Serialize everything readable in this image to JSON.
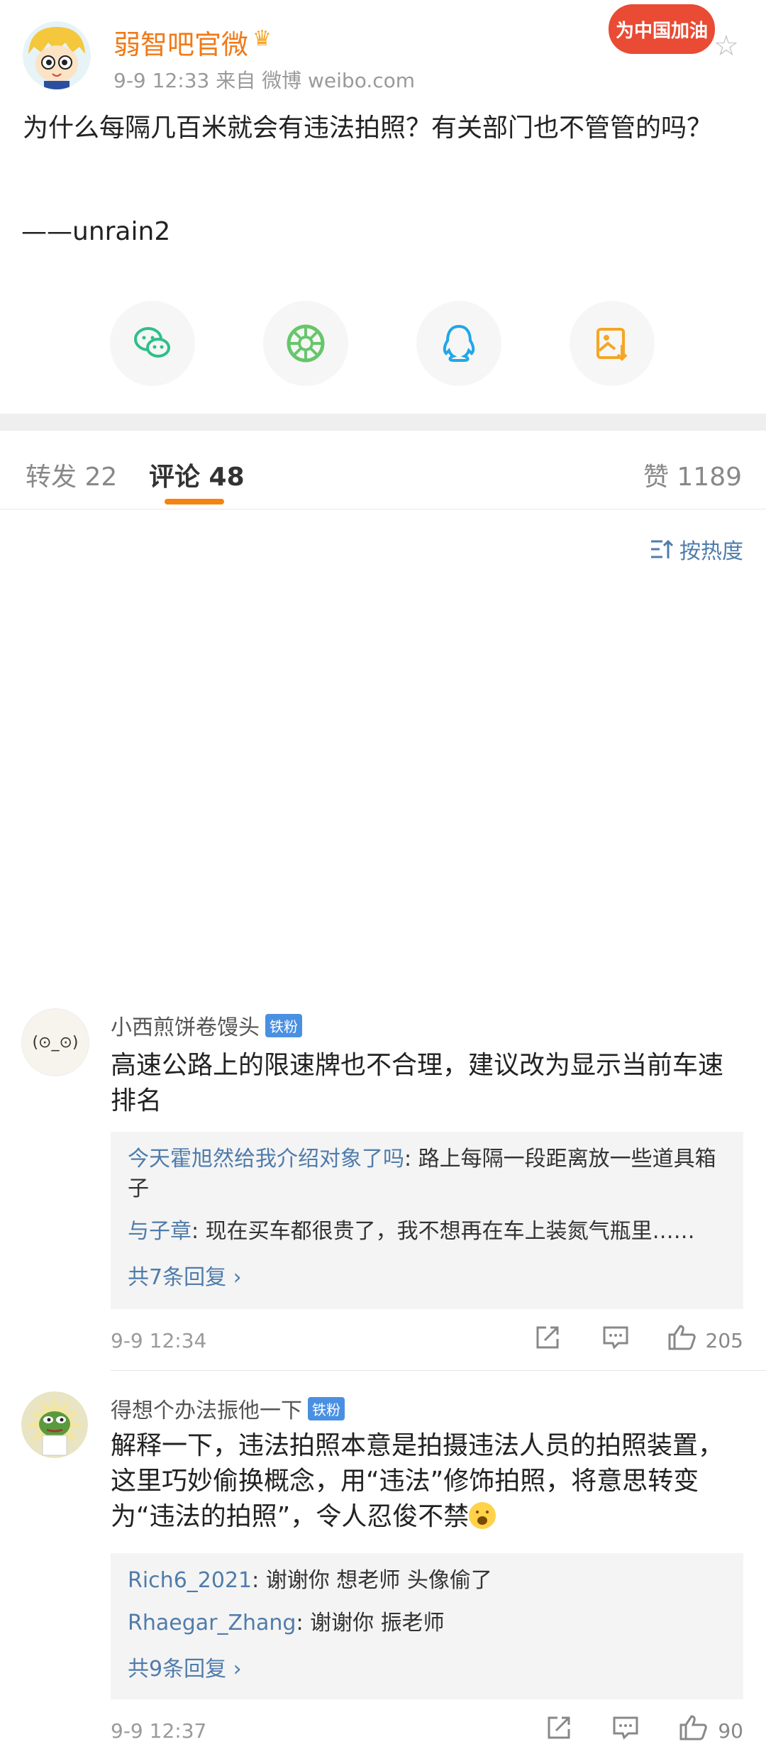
{
  "post": {
    "author": "弱智吧官微",
    "meta": "9-9 12:33   来自 微博 weibo.com",
    "promo_label": "为中国加油",
    "text": "为什么每隔几百米就会有违法拍照？有关部门也不管管的吗？",
    "signature": "——unrain2"
  },
  "share": {
    "icons": [
      "wechat-icon",
      "moments-icon",
      "qq-icon",
      "save-image-icon"
    ],
    "colors": [
      "#2dc089",
      "#66c66b",
      "#1fa7e8",
      "#f5a623"
    ]
  },
  "tabs": {
    "repost": "转发 22",
    "comments": "评论 48",
    "likes": "赞 1189"
  },
  "sort_label": "按热度",
  "comments": [
    {
      "user": "小西煎饼卷馒头",
      "badge": "铁粉",
      "avatar_text": "(⊙_⊙)",
      "text": "高速公路上的限速牌也不合理，建议改为显示当前车速排名",
      "replies": [
        {
          "user": "今天霍旭然给我介绍对象了吗",
          "text": ": 路上每隔一段距离放一些道具箱子"
        },
        {
          "user": "与子章",
          "text": ": 现在买车都很贵了，我不想再在车上装氮气瓶里……"
        }
      ],
      "more": "共7条回复 ›",
      "time": "9-9 12:34",
      "likes": "205"
    },
    {
      "user": "得想个办法振他一下",
      "badge": "铁粉",
      "text": "解释一下，违法拍照本意是拍摄违法人员的拍照装置，这里巧妙偷换概念，用“违法”修饰拍照，将意思转变为“违法的拍照”，令人忍俊不禁",
      "replies": [
        {
          "user": "Rich6_2021",
          "text": ": 谢谢你 想老师 头像偷了"
        },
        {
          "user": "Rhaegar_Zhang",
          "text": ": 谢谢你 振老师"
        }
      ],
      "more": "共9条回复 ›",
      "time": "9-9 12:37",
      "likes": "90"
    }
  ]
}
